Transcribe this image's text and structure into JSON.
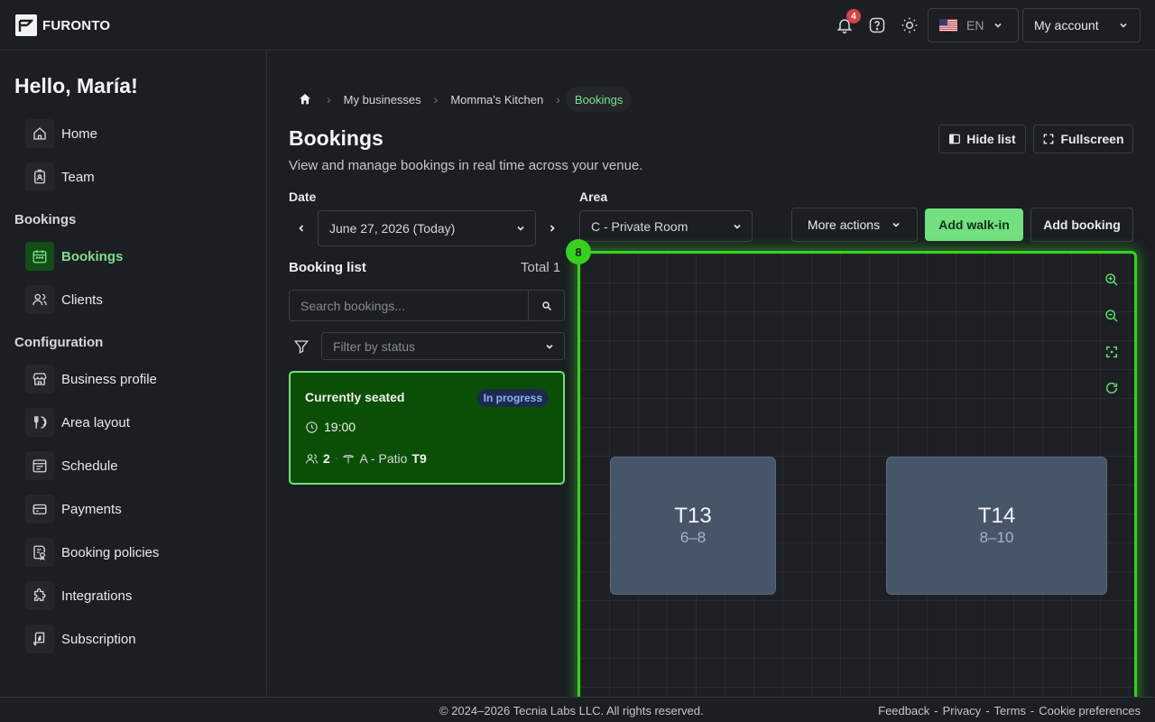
{
  "brand": {
    "name": "FURONTO"
  },
  "topbar": {
    "notification_count": "4",
    "language": "EN",
    "account_label": "My account"
  },
  "sidebar": {
    "greeting": "Hello, María!",
    "items_top": [
      {
        "label": "Home",
        "icon": "home-icon"
      },
      {
        "label": "Team",
        "icon": "badge-icon"
      }
    ],
    "section_bookings": "Bookings",
    "items_bookings": [
      {
        "label": "Bookings",
        "icon": "calendar-icon",
        "active": true
      },
      {
        "label": "Clients",
        "icon": "users-icon"
      }
    ],
    "section_config": "Configuration",
    "items_config": [
      {
        "label": "Business profile",
        "icon": "store-icon"
      },
      {
        "label": "Area layout",
        "icon": "utensils-icon"
      },
      {
        "label": "Schedule",
        "icon": "schedule-icon"
      },
      {
        "label": "Payments",
        "icon": "card-icon"
      },
      {
        "label": "Booking policies",
        "icon": "policy-icon"
      },
      {
        "label": "Integrations",
        "icon": "puzzle-icon"
      },
      {
        "label": "Subscription",
        "icon": "subscription-icon"
      }
    ]
  },
  "breadcrumb": [
    "My businesses",
    "Momma's Kitchen",
    "Bookings"
  ],
  "page": {
    "title": "Bookings",
    "subtitle": "View and manage bookings in real time across your venue."
  },
  "toolbar": {
    "hide_list": "Hide list",
    "fullscreen": "Fullscreen",
    "more_actions": "More actions",
    "add_walkin": "Add walk-in",
    "add_booking": "Add booking"
  },
  "filters": {
    "date_label": "Date",
    "date_value": "June 27, 2026 (Today)",
    "area_label": "Area",
    "area_value": "C - Private Room"
  },
  "booking_list": {
    "title": "Booking list",
    "total": "Total 1",
    "search_placeholder": "Search bookings...",
    "status_placeholder": "Filter by status",
    "cards": [
      {
        "title": "Currently seated",
        "status": "In progress",
        "time": "19:00",
        "guests": "2",
        "area": "A - Patio",
        "table": "T9"
      }
    ]
  },
  "floor_plan": {
    "seated_count": "8",
    "tables": [
      {
        "name": "T13",
        "capacity": "6–8"
      },
      {
        "name": "T14",
        "capacity": "8–10"
      }
    ]
  },
  "footer": {
    "copyright": "© 2024–2026 Tecnia Labs LLC. All rights reserved.",
    "links": [
      "Feedback",
      "Privacy",
      "Terms",
      "Cookie preferences"
    ]
  },
  "colors": {
    "accent": "#72e07f",
    "floor_border": "#35d11e",
    "card_bg": "#0b4f07",
    "table_bg": "#475569"
  }
}
